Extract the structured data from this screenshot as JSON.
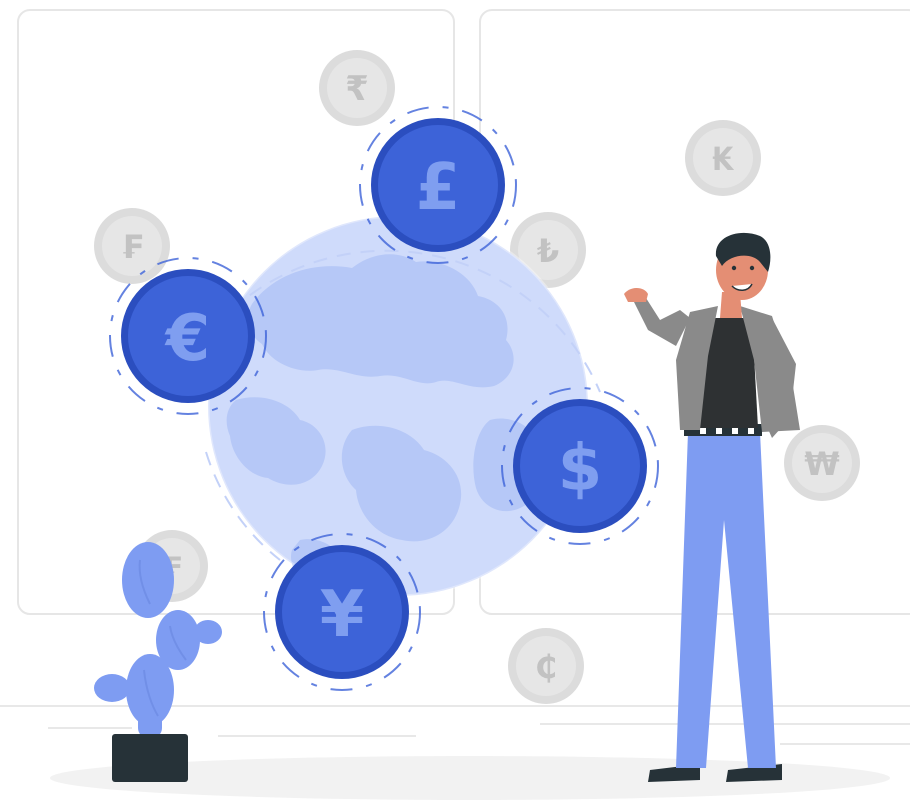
{
  "main_coins": [
    {
      "id": "pound",
      "symbol": "£"
    },
    {
      "id": "euro",
      "symbol": "€"
    },
    {
      "id": "dollar",
      "symbol": "$"
    },
    {
      "id": "yen",
      "symbol": "¥"
    }
  ],
  "background_coins": [
    {
      "id": "rupee",
      "symbol": "₹"
    },
    {
      "id": "kip",
      "symbol": "₭"
    },
    {
      "id": "franc",
      "symbol": "₣"
    },
    {
      "id": "lira",
      "symbol": "₺"
    },
    {
      "id": "won",
      "symbol": "₩"
    },
    {
      "id": "cedi",
      "symbol": "₵"
    },
    {
      "id": "hidden",
      "symbol": "₣"
    }
  ],
  "colors": {
    "coin_blue": "#3d63d8",
    "coin_blue_dark": "#2b4ebf",
    "coin_symbol": "#7f9ef0",
    "globe_light": "#cfdbfb",
    "globe_land": "#b6c8f7",
    "grey_coin": "#dcdcdc",
    "grey_symbol": "#c2c2c2",
    "panel_border": "#e6e6e6",
    "person_jeans": "#7e9cf2",
    "person_jacket": "#8a8a8a",
    "person_shirt": "#2e3133",
    "skin": "#e48e74",
    "hair": "#263238",
    "pot": "#263238",
    "cactus": "#7e9cf2"
  }
}
